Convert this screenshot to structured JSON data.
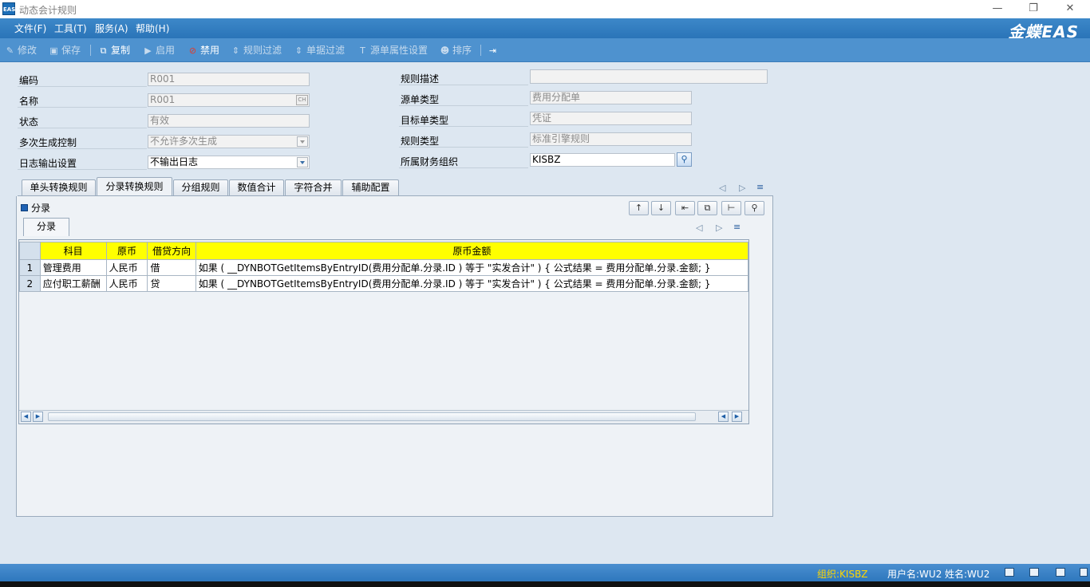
{
  "window": {
    "title": "动态会计规则",
    "app_icon": "EAS",
    "brand": "金蝶EAS",
    "minimize_icon": "minimize-icon",
    "restore_icon": "restore-icon",
    "close_icon": "close-icon"
  },
  "menu": [
    "文件(F)",
    "工具(T)",
    "服务(A)",
    "帮助(H)"
  ],
  "toolbar": {
    "edit": "修改",
    "save": "保存",
    "copy": "复制",
    "enable": "启用",
    "disable": "禁用",
    "rule_filter": "规则过滤",
    "bill_filter": "单据过滤",
    "source_attr": "源单属性设置",
    "sort": "排序"
  },
  "form": {
    "code_label": "编码",
    "code_value": "R001",
    "name_label": "名称",
    "name_value": "R001",
    "name_lang": "CH",
    "status_label": "状态",
    "status_value": "有效",
    "multi_label": "多次生成控制",
    "multi_value": "不允许多次生成",
    "log_label": "日志输出设置",
    "log_value": "不输出日志",
    "desc_label": "规则描述",
    "desc_value": "",
    "src_type_label": "源单类型",
    "src_type_value": "费用分配单",
    "tgt_type_label": "目标单类型",
    "tgt_type_value": "凭证",
    "rule_type_label": "规则类型",
    "rule_type_value": "标准引擎规则",
    "org_label": "所属财务组织",
    "org_value": "KISBZ"
  },
  "tabs": [
    "单头转换规则",
    "分录转换规则",
    "分组规则",
    "数值合计",
    "字符合并",
    "辅助配置"
  ],
  "selected_tab": 1,
  "section": {
    "title": "分录",
    "subtab": "分录"
  },
  "grid": {
    "columns": [
      "科目",
      "原币",
      "借贷方向",
      "原币金额"
    ],
    "rows": [
      {
        "no": "1",
        "account": "管理费用",
        "currency": "人民币",
        "direction": "借",
        "amount": "如果 (   __DYNBOTGetItemsByEntryID(费用分配单.分录.ID ) 等于 \"实发合计\"   ) {    公式结果  =  费用分配单.分录.金额; }"
      },
      {
        "no": "2",
        "account": "应付职工薪酬",
        "currency": "人民币",
        "direction": "贷",
        "amount": "如果 (   __DYNBOTGetItemsByEntryID(费用分配单.分录.ID ) 等于 \"实发合计\"   ) {    公式结果  =  费用分配单.分录.金额; }"
      }
    ]
  },
  "status": {
    "org": "组织:KISBZ",
    "user": "用户名:WU2",
    "name": "姓名:WU2"
  },
  "colors": {
    "menubar": "#2a74b8",
    "toolbar": "#4e92cf",
    "grid_header": "#ffff00",
    "statusbar": "#2e77bd"
  }
}
